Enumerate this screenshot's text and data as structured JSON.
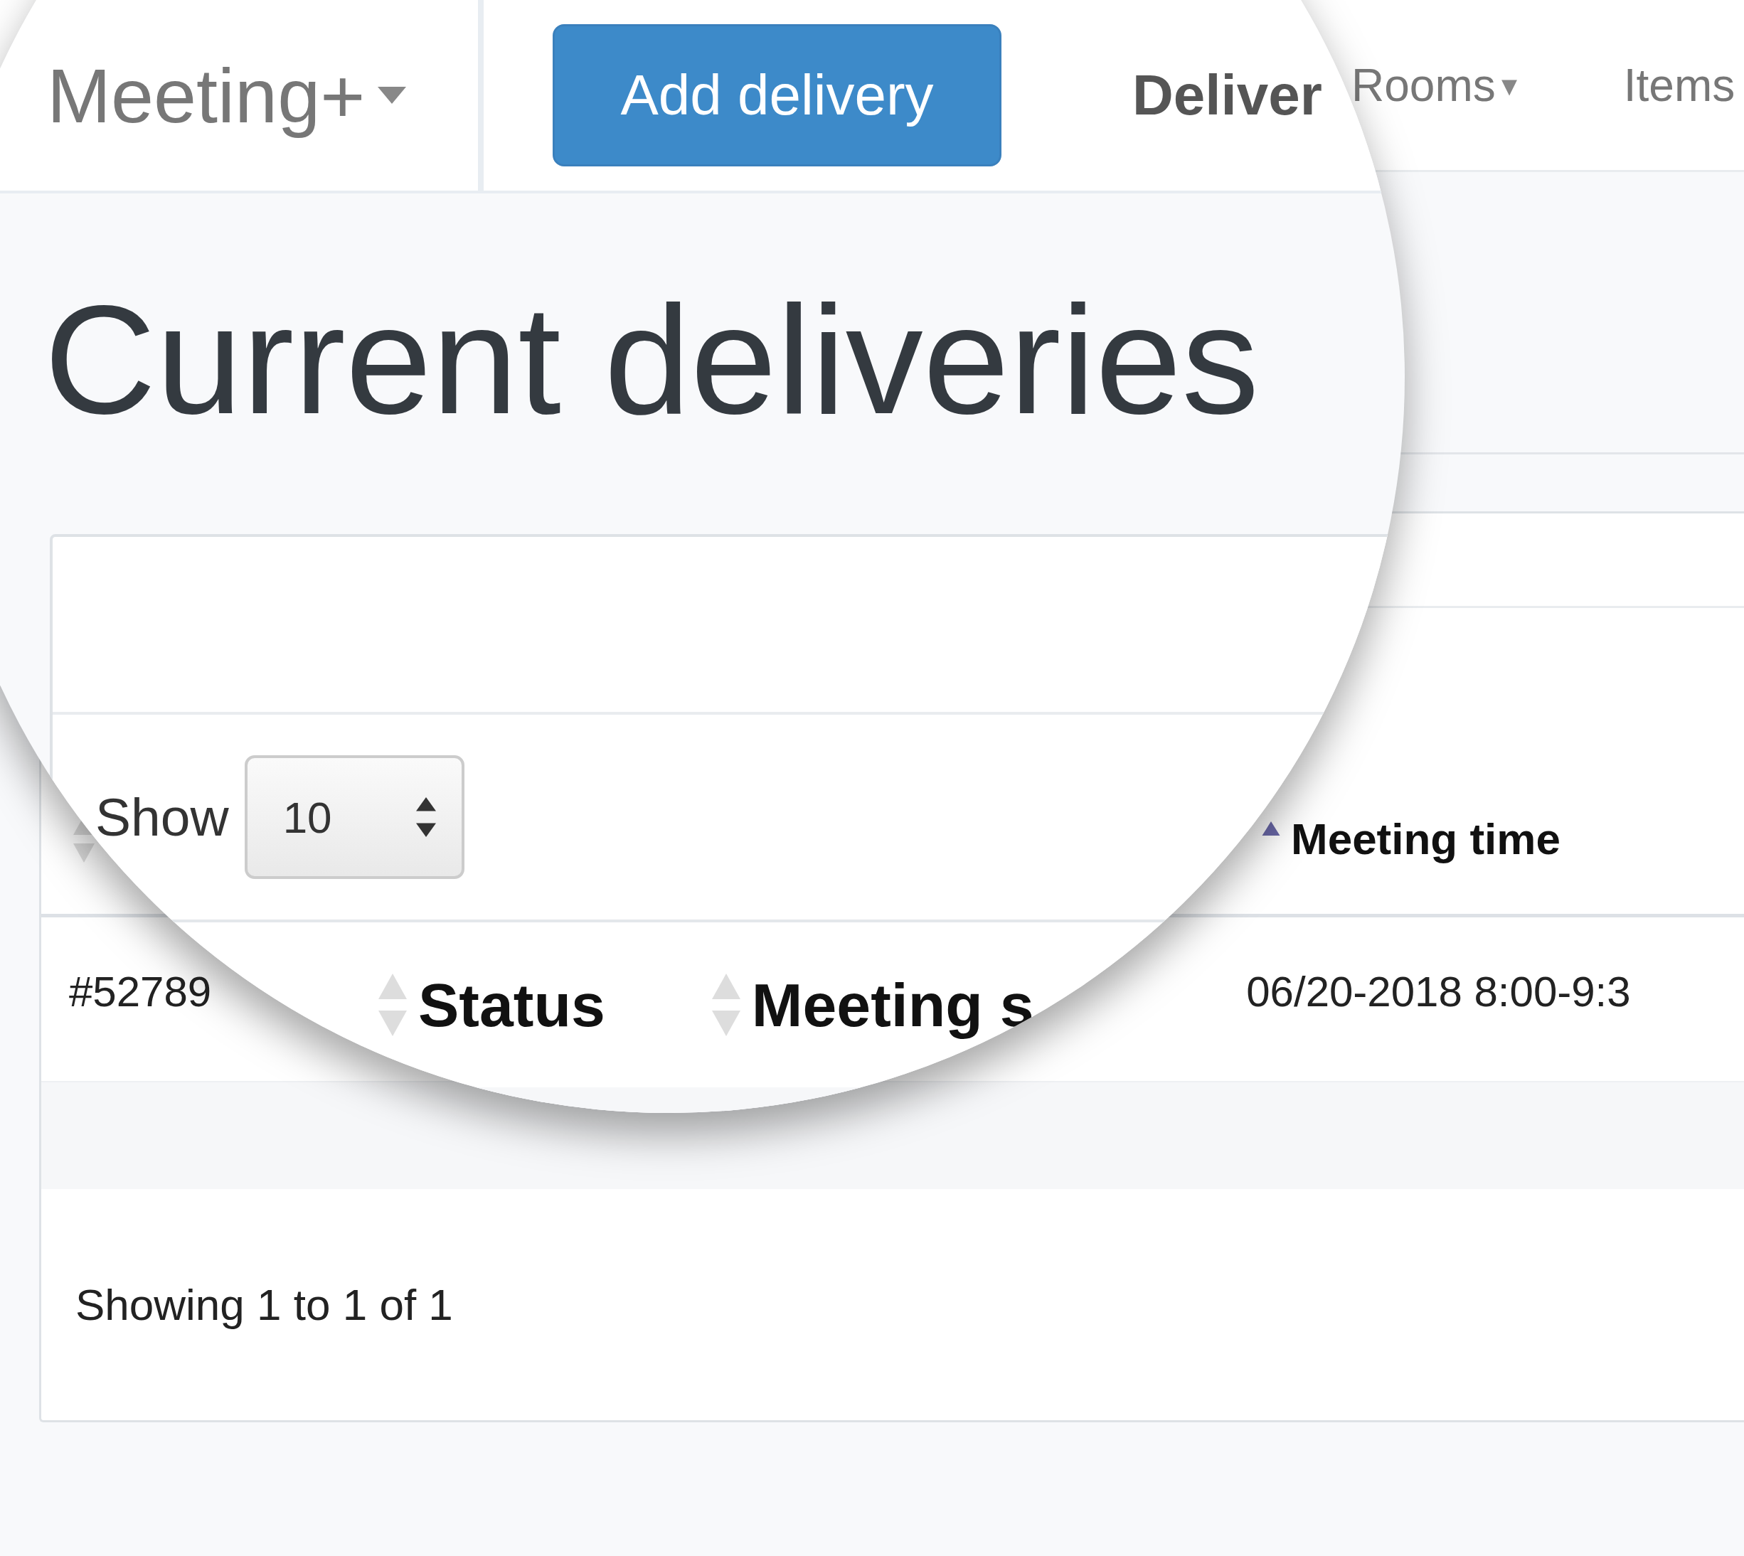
{
  "page": {
    "nav_items": [
      {
        "label": "Rooms",
        "caret": "▾"
      },
      {
        "label": "Items"
      }
    ],
    "column_header": "Meeting time",
    "row": {
      "id": "#52789",
      "meeting_time": "06/20-2018 8:00-9:3"
    },
    "footer": "Showing 1 to 1 of 1"
  },
  "magnifier": {
    "brand": "Meeting+",
    "add_button": "Add delivery",
    "nav_item": "Deliver",
    "heading": "Current deliveries",
    "length_label": "Show",
    "length_value": "10",
    "columns": [
      "Status",
      "Meeting s"
    ]
  }
}
